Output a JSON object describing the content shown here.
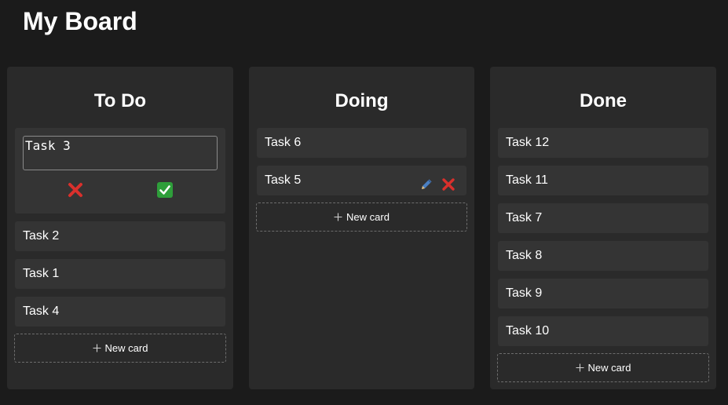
{
  "board": {
    "title": "My Board"
  },
  "columns": {
    "todo": {
      "title": "To Do",
      "editing": {
        "value": "Task 3"
      },
      "cards": [
        "Task 2",
        "Task 1",
        "Task 4"
      ],
      "new_card_label": "New card"
    },
    "doing": {
      "title": "Doing",
      "cards": [
        "Task 6",
        "Task 5"
      ],
      "new_card_label": "New card"
    },
    "done": {
      "title": "Done",
      "cards": [
        "Task 12",
        "Task 11",
        "Task 7",
        "Task 8",
        "Task 9",
        "Task 10"
      ],
      "new_card_label": "New card"
    }
  },
  "icons": {
    "cancel": "cross-mark-icon",
    "confirm": "check-mark-icon",
    "edit": "pen-icon",
    "delete": "cross-mark-icon",
    "add": "plus-icon"
  },
  "colors": {
    "background": "#1b1b1b",
    "column": "#2a2a2a",
    "card": "#343434",
    "cancel": "#d9302c",
    "confirm": "#2e9e3a",
    "edit": "#4a7fc1"
  }
}
